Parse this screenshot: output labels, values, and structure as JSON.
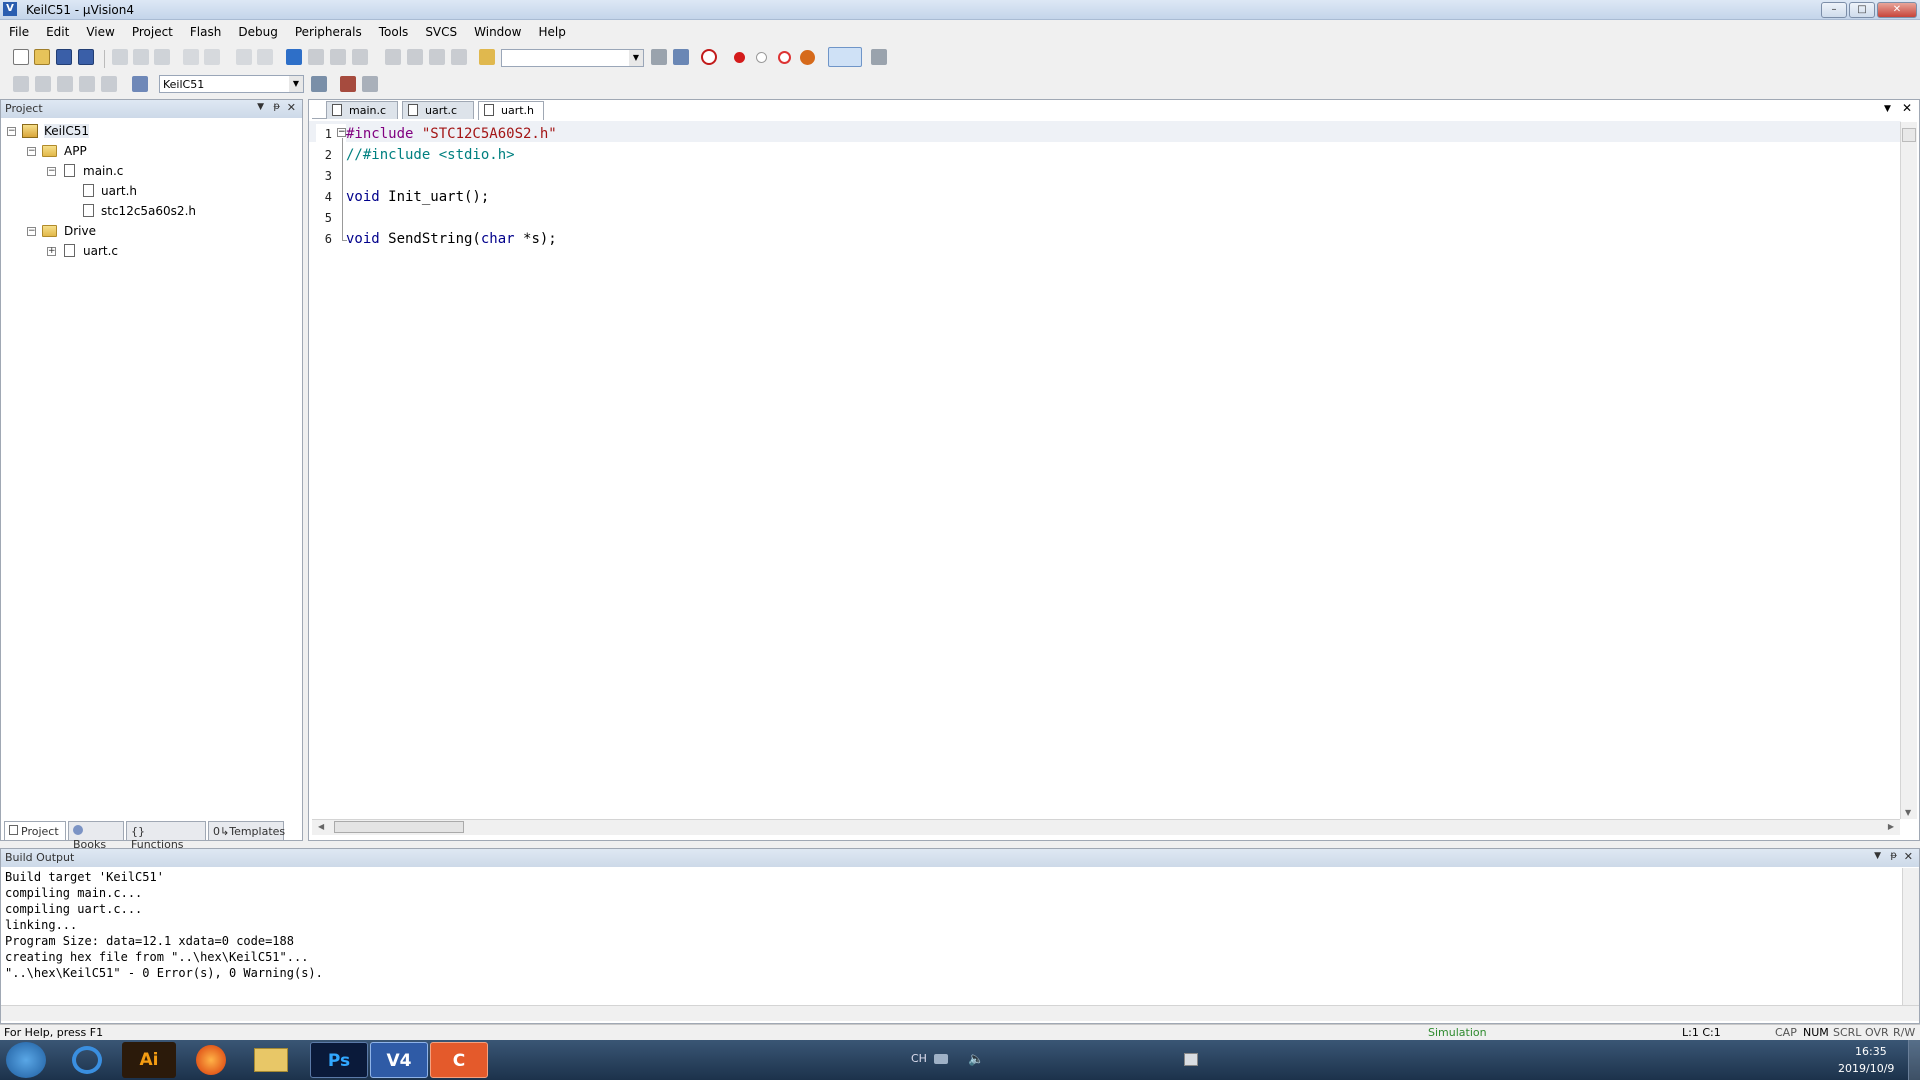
{
  "window": {
    "title": "KeilC51  - µVision4",
    "minimize": "–",
    "maximize": "□",
    "close": "✕"
  },
  "menu": [
    "File",
    "Edit",
    "View",
    "Project",
    "Flash",
    "Debug",
    "Peripherals",
    "Tools",
    "SVCS",
    "Window",
    "Help"
  ],
  "toolbar": {
    "target": "KeilC51"
  },
  "project_pane": {
    "title": "Project",
    "tree": {
      "root": "KeilC51",
      "group1": "APP",
      "file_main": "main.c",
      "file_uart_h": "uart.h",
      "file_stc": "stc12c5a60s2.h",
      "group2": "Drive",
      "file_uart_c": "uart.c"
    },
    "tabs": [
      "Project",
      "Books",
      "Functions",
      "Templates"
    ],
    "tab_icons": {
      "functions": "{}",
      "templates": "0↳"
    }
  },
  "editor": {
    "tabs": [
      "main.c",
      "uart.c",
      "uart.h"
    ],
    "active_tab": "uart.h",
    "lines": [
      {
        "n": "1",
        "pre": "#include ",
        "str": "\"STC12C5A60S2.h\""
      },
      {
        "n": "2",
        "cmt": "//#include <stdio.h>"
      },
      {
        "n": "3"
      },
      {
        "n": "4",
        "kw": "void",
        "rest": " Init_uart();"
      },
      {
        "n": "5"
      },
      {
        "n": "6",
        "kw": "void",
        "rest": " SendString(",
        "kw2": "char",
        "rest2": " *s);"
      }
    ]
  },
  "build_output": {
    "title": "Build Output",
    "lines": [
      "Build target 'KeilC51'",
      "compiling main.c...",
      "compiling uart.c...",
      "linking...",
      "Program Size: data=12.1 xdata=0 code=188",
      "creating hex file from \"..\\hex\\KeilC51\"...",
      "\"..\\hex\\KeilC51\" - 0 Error(s), 0 Warning(s)."
    ]
  },
  "status": {
    "help": "For Help, press F1",
    "mode": "Simulation",
    "pos": "L:1 C:1",
    "cap": "CAP",
    "num": "NUM",
    "scrl": "SCRL",
    "ovr": "OVR",
    "rw": "R/W"
  },
  "taskbar": {
    "apps": [
      "Ai",
      "Ps",
      "V4"
    ],
    "tray": {
      "lang": "CH",
      "time": "16:35",
      "date": "2019/10/9"
    }
  },
  "colors": {
    "keyword": "#00008b",
    "preprocessor": "#800080",
    "string": "#a31515",
    "comment": "#008080",
    "status_mode": "#2f8b2f"
  }
}
